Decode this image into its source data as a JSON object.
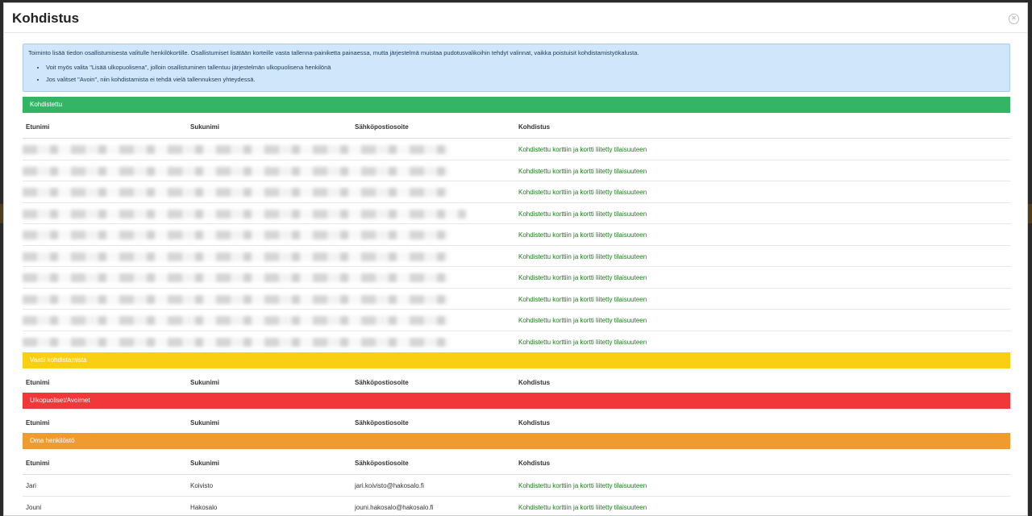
{
  "modal": {
    "title": "Kohdistus"
  },
  "info": {
    "text": "Toiminto lisää tiedon osallistumisesta valitulle henkilökortille. Osallistumiset lisätään korteille vasta tallenna-painiketta painaessa, mutta järjestelmä muistaa pudotusvalikoihin tehdyt valinnat, vaikka poistuisit kohdistamistyökalusta.",
    "bullets": [
      "Voit myös valita \"Lisää ulkopuolisena\", jolloin osallistuminen tallentuu järjestelmän ulkopuolisena henkilönä",
      "Jos valitset \"Avoin\", niin kohdistamista ei tehdä vielä tallennuksen yhteydessä."
    ]
  },
  "columns": {
    "first": "Etunimi",
    "last": "Sukunimi",
    "email": "Sähköpostiosoite",
    "target": "Kohdistus"
  },
  "sections": {
    "kohdistettu": {
      "label": "Kohdistettu",
      "color": "#34b566",
      "rows": [
        {
          "status": "Kohdistettu korttiin ja kortti liitetty tilaisuuteen"
        },
        {
          "status": "Kohdistettu korttiin ja kortti liitetty tilaisuuteen"
        },
        {
          "status": "Kohdistettu korttiin ja kortti liitetty tilaisuuteen"
        },
        {
          "status": "Kohdistettu korttiin ja kortti liitetty tilaisuuteen"
        },
        {
          "status": "Kohdistettu korttiin ja kortti liitetty tilaisuuteen"
        },
        {
          "status": "Kohdistettu korttiin ja kortti liitetty tilaisuuteen"
        },
        {
          "status": "Kohdistettu korttiin ja kortti liitetty tilaisuuteen"
        },
        {
          "status": "Kohdistettu korttiin ja kortti liitetty tilaisuuteen"
        },
        {
          "status": "Kohdistettu korttiin ja kortti liitetty tilaisuuteen"
        },
        {
          "status": "Kohdistettu korttiin ja kortti liitetty tilaisuuteen"
        }
      ]
    },
    "vaatii": {
      "label": "Vaatii kohdistamista",
      "color": "#f8cf12"
    },
    "ulkopuoliset": {
      "label": "Ulkopuoliset/Avoimet",
      "color": "#f2373a"
    },
    "oma": {
      "label": "Oma henkilöstö",
      "color": "#ee9c31",
      "rows": [
        {
          "first": "Jari",
          "last": "Koivisto",
          "email": "jari.koivisto@hakosalo.fi",
          "status": "Kohdistettu korttiin ja kortti liitetty tilaisuuteen"
        },
        {
          "first": "Jouni",
          "last": "Hakosalo",
          "email": "jouni.hakosalo@hakosalo.fi",
          "status": "Kohdistettu korttiin ja kortti liitetty tilaisuuteen"
        }
      ]
    }
  }
}
